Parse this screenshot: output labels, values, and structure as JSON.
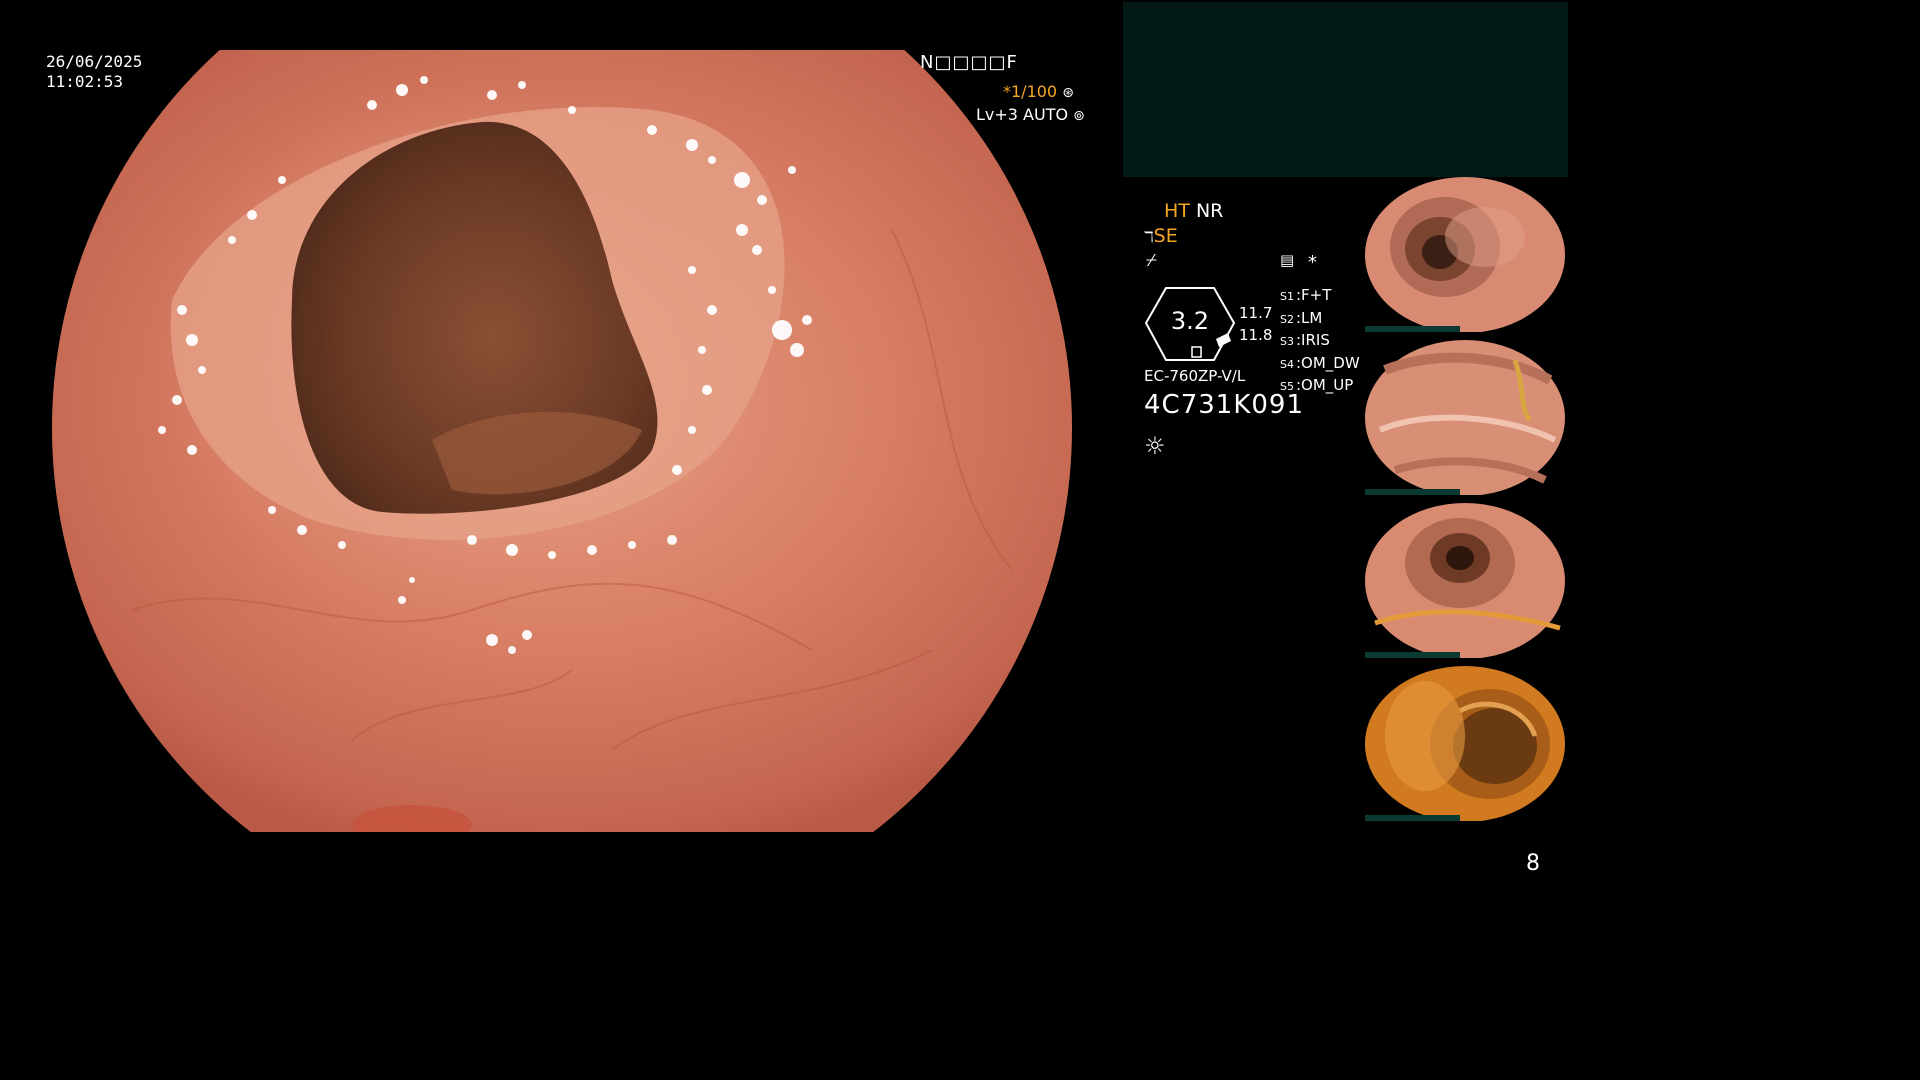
{
  "overlay": {
    "date": "26/06/2025",
    "time": "11:02:53",
    "header_code": "N□□□□F",
    "shutter": "*1/100",
    "shutter_icon": "aperture-icon",
    "level": "Lv+3 AUTO",
    "level_icon": "auto-iris-icon"
  },
  "sidebar": {
    "ht": "HT",
    "nr": "NR",
    "se": "SE",
    "se_icon": "scope-icon",
    "freeze_icon": "freeze-icon",
    "memo_icon": "memo-icon",
    "asterisk": "*",
    "dial_value": "3.2",
    "val_a": "11.7",
    "val_b": "11.8",
    "scope_model": "EC-760ZP-V/L",
    "serial": "4C731K091",
    "light_icon": "light-source-icon",
    "switches": [
      {
        "key": "S1",
        "label": "F+T"
      },
      {
        "key": "S2",
        "label": "LM"
      },
      {
        "key": "S3",
        "label": "IRIS"
      },
      {
        "key": "S4",
        "label": "OM_DW"
      },
      {
        "key": "S5",
        "label": "OM_UP"
      }
    ]
  },
  "thumbnails": [
    {
      "name": "capture-1"
    },
    {
      "name": "capture-2"
    },
    {
      "name": "capture-3"
    },
    {
      "name": "capture-4"
    }
  ],
  "page_number": "8",
  "colors": {
    "amber": "#f5a623",
    "panel": "#031a17",
    "mucosa": "#d47b63"
  }
}
